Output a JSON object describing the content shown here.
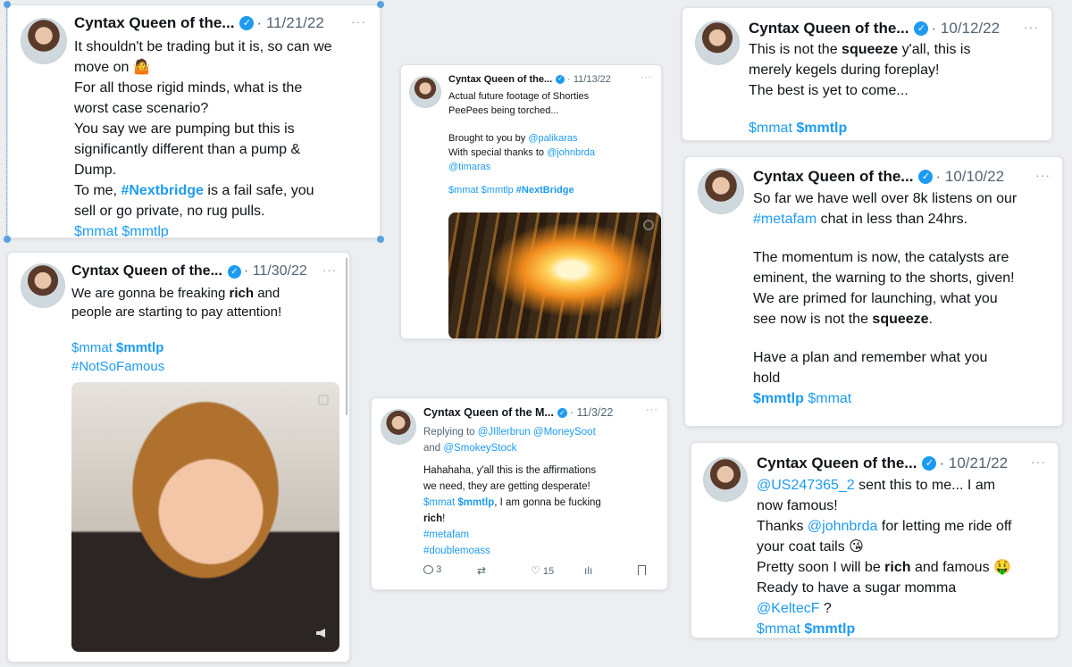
{
  "colors": {
    "link": "#1d9bf0",
    "verified": "#1d9bf0",
    "muted": "#536471"
  },
  "icons": {
    "verified": "verified-badge-icon",
    "more": "more-icon",
    "reply": "reply-icon",
    "retweet": "retweet-icon",
    "like": "like-icon",
    "views": "views-icon",
    "bookmark": "bookmark-icon",
    "video_menu": "video-menu-icon",
    "mute": "mute-icon"
  },
  "common": {
    "badge": "✓",
    "more": "···"
  },
  "tweets": {
    "t1": {
      "name": "Cyntax Queen of the...",
      "date": "· 11/21/22",
      "lines": [
        "It shouldn't be trading but it is, so can we",
        "move on 🤷",
        "For all those rigid minds, what is the",
        "worst case scenario?",
        "You say we are pumping but this is",
        "significantly different than a pump &",
        "Dump.",
        "To me, ",
        "#Nextbridge",
        " is a fail safe, you",
        "sell or go private, no rug pulls.",
        "$mmat $mmtlp"
      ]
    },
    "t2": {
      "name": "Cyntax Queen of the...",
      "date": "· 11/30/22",
      "lines": [
        "We are gonna be freaking ",
        "rich",
        " and",
        "people are starting to pay attention!",
        "$mmat ",
        "$mmtlp",
        "#NotSoFamous"
      ]
    },
    "t3": {
      "name": "Cyntax Queen of the...",
      "date": "· 11/13/22",
      "lines": [
        "Actual future footage of Shorties",
        "PeePees being torched...",
        "Brought to you by ",
        "@palikaras",
        "With special thanks to ",
        "@johnbrda",
        "@timaras",
        "$mmat $mmtlp ",
        "#NextBridge"
      ]
    },
    "t4": {
      "name": "Cyntax Queen of the M...",
      "date": "· 11/3/22",
      "replying": "Replying to ",
      "replying_links": [
        "@JIllerbrun",
        " @MoneySoot",
        "and ",
        "@SmokeyStock"
      ],
      "lines": [
        "Hahahaha, y'all this is the affirmations",
        "we need, they are getting desperate!",
        "$mmat ",
        "$mmtlp",
        ", I am gonna be fucking",
        "rich",
        "!",
        "#metafam",
        "#doublemoass"
      ],
      "counts": {
        "replies": "3",
        "likes": "15"
      }
    },
    "t5": {
      "name": "Cyntax Queen of the...",
      "date": "· 10/12/22",
      "lines": [
        "This is not the ",
        "squeeze",
        " y'all, this is",
        "merely kegels during foreplay!",
        "The best is yet to come...",
        "$mmat ",
        "$mmtlp"
      ]
    },
    "t6": {
      "name": "Cyntax Queen of the...",
      "date": "· 10/10/22",
      "lines": [
        "So far we have well over 8k listens on our",
        "#metafam",
        " chat in less than 24hrs.",
        "The momentum is now, the catalysts are",
        "eminent, the warning to the shorts, given!",
        "We are primed for launching, what you",
        "see now is not the ",
        "squeeze",
        ".",
        "Have a plan and remember what you",
        "hold",
        "$mmtlp",
        " $mmat"
      ]
    },
    "t7": {
      "name": "Cyntax Queen of the...",
      "date": "· 10/21/22",
      "lines": [
        "@US247365_2",
        " sent this to me... I am",
        "now famous!",
        "Thanks ",
        "@johnbrda",
        " for letting me ride off",
        "your coat tails 😘",
        "Pretty soon I will be ",
        "rich",
        " and famous 🤑",
        "Ready to have a sugar momma",
        "@KeltecF",
        " ?",
        "$mmat ",
        "$mmtlp"
      ]
    }
  }
}
